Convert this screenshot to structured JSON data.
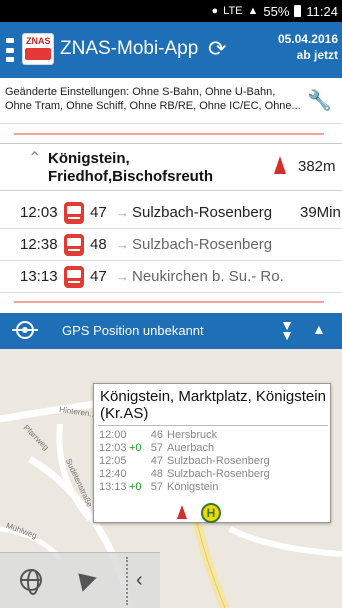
{
  "status_bar": {
    "lte": "LTE",
    "battery": "55%",
    "time": "11:24"
  },
  "header": {
    "title": "ZNAS-Mobi-App",
    "logo_text": "ZNAS",
    "date": "05.04.2016",
    "subtitle": "ab jetzt"
  },
  "settings": {
    "line1": "Geänderte Einstellungen: Ohne S-Bahn, Ohne U-Bahn,",
    "line2": "Ohne Tram, Ohne Schiff, Ohne RB/RE, Ohne IC/EC, Ohne..."
  },
  "stop": {
    "name_line1": "Königstein,",
    "name_line2": "Friedhof,Bischofsreuth",
    "distance": "382m"
  },
  "departures": [
    {
      "time": "12:03",
      "line": "47",
      "destination": "Sulzbach-Rosenberg",
      "delta": "39Min"
    },
    {
      "time": "12:38",
      "line": "48",
      "destination": "Sulzbach-Rosenberg",
      "delta": ""
    },
    {
      "time": "13:13",
      "line": "47",
      "destination": "Neukirchen b. Su.- Ro.",
      "delta": ""
    }
  ],
  "gps": {
    "text": "GPS Position unbekannt"
  },
  "map": {
    "streets": [
      "Hinteren...",
      "Pfarrweg",
      "Sudetenstraße",
      "Mühlweg"
    ],
    "marker_letter": "H",
    "popup": {
      "title": "Königstein, Marktplatz, Königstein (Kr.AS)",
      "rows": [
        {
          "time": "12:00",
          "delay": "",
          "line": "46",
          "dest": "Hersbruck"
        },
        {
          "time": "12:03",
          "delay": "+0",
          "line": "57",
          "dest": "Auerbach"
        },
        {
          "time": "12:05",
          "delay": "",
          "line": "47",
          "dest": "Sulzbach-Rosenberg"
        },
        {
          "time": "12:40",
          "delay": "",
          "line": "48",
          "dest": "Sulzbach-Rosenberg"
        },
        {
          "time": "13:13",
          "delay": "+0",
          "line": "57",
          "dest": "Königstein"
        }
      ]
    }
  },
  "colors": {
    "primary": "#1f6fb7",
    "bus": "#e53935",
    "delay_ok": "#1b9a1b"
  }
}
